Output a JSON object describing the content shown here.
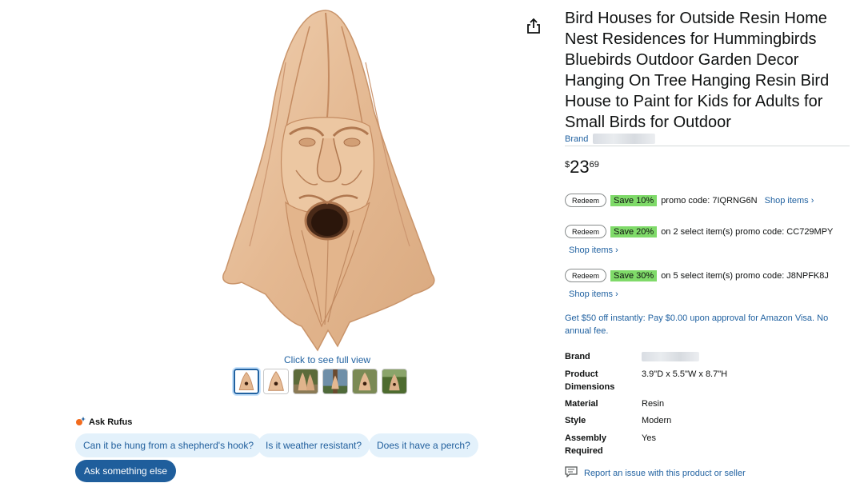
{
  "product": {
    "title": "Bird Houses for Outside Resin Home Nest Residences for Hummingbirds Bluebirds Outdoor Garden Decor Hanging On Tree Hanging Resin Bird House to Paint for Kids for Adults for Small Birds for Outdoor",
    "brand_prefix": "Brand",
    "price_symbol": "$",
    "price_whole": "23",
    "price_fraction": "69"
  },
  "gallery": {
    "click_full": "Click to see full view",
    "thumbnail_count": 6,
    "selected_index": 0
  },
  "promos": [
    {
      "redeem": "Redeem",
      "save": "Save 10%",
      "text": "promo code: 7IQRNG6N",
      "shop": "Shop items ›"
    },
    {
      "redeem": "Redeem",
      "save": "Save 20%",
      "text": "on 2 select item(s) promo code: CC729MPY",
      "shop": "Shop items ›"
    },
    {
      "redeem": "Redeem",
      "save": "Save 30%",
      "text": "on 5 select item(s) promo code: J8NPFK8J",
      "shop": "Shop items ›"
    }
  ],
  "visa_offer": "Get $50 off instantly: Pay $0.00 upon approval for Amazon Visa. No annual fee.",
  "specs": [
    {
      "label": "Brand",
      "value": ""
    },
    {
      "label": "Product Dimensions",
      "value": "3.9\"D x 5.5\"W x 8.7\"H"
    },
    {
      "label": "Material",
      "value": "Resin"
    },
    {
      "label": "Style",
      "value": "Modern"
    },
    {
      "label": "Assembly Required",
      "value": "Yes"
    }
  ],
  "report_link": "Report an issue with this product or seller",
  "rufus": {
    "title": "Ask Rufus",
    "chips": [
      "Can it be hung from a shepherd's hook?",
      "Is it weather resistant?",
      "Does it have a perch?"
    ],
    "ask_else": "Ask something else"
  },
  "colors": {
    "link": "#2162a1",
    "save_tag": "#7fda69",
    "rufus_chip": "#e3f1fb",
    "rufus_button": "#1f5e9c",
    "resin": "#e8bf9a"
  }
}
